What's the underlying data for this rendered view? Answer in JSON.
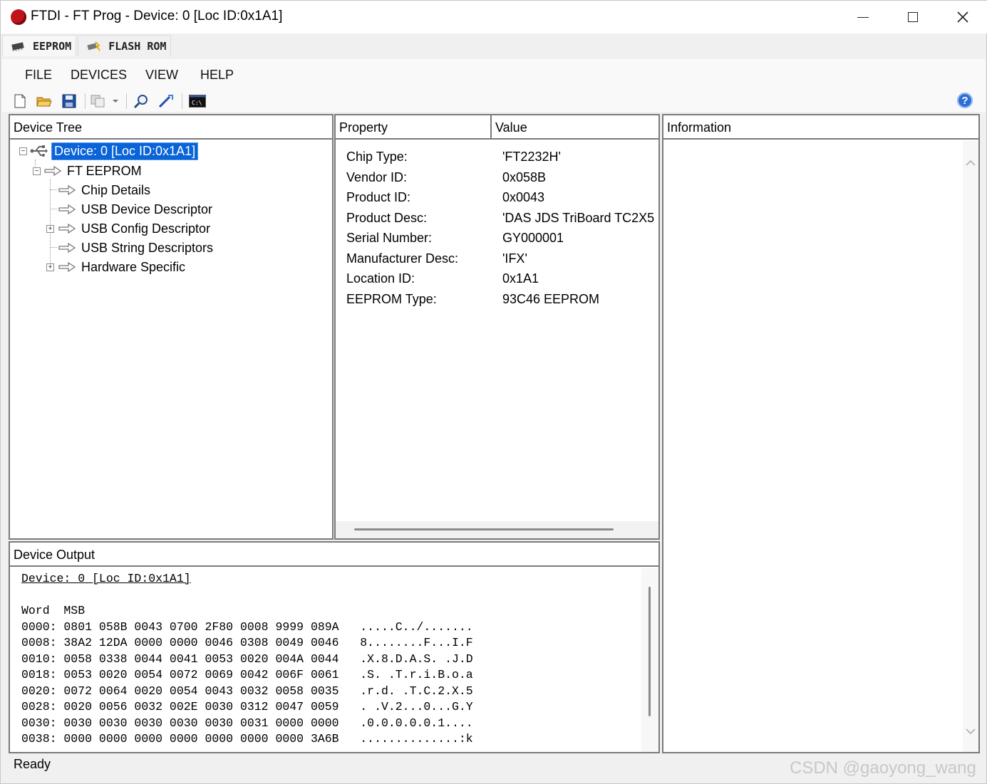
{
  "window": {
    "title": "FTDI - FT Prog - Device: 0 [Loc ID:0x1A1]",
    "controls": {
      "minimize": "minimize-icon",
      "maximize": "maximize-icon",
      "close": "close-icon"
    }
  },
  "tabs": [
    {
      "label": "EEPROM",
      "icon": "chip-icon"
    },
    {
      "label": "FLASH ROM",
      "icon": "flash-icon"
    }
  ],
  "menu": [
    "FILE",
    "DEVICES",
    "VIEW",
    "HELP"
  ],
  "toolbar": {
    "icons": [
      "new-file-icon",
      "open-folder-icon",
      "save-icon",
      "copy-icon",
      "dropdown-icon",
      "search-icon",
      "program-icon",
      "cmd-icon",
      "help-icon"
    ],
    "cmd_label": "C:\\",
    "help_label": "?"
  },
  "device_tree": {
    "header": "Device Tree",
    "root": "Device: 0 [Loc ID:0x1A1]",
    "eeprom": "FT EEPROM",
    "children": [
      "Chip Details",
      "USB Device Descriptor",
      "USB Config Descriptor",
      "USB String Descriptors",
      "Hardware Specific"
    ]
  },
  "properties": {
    "header_property": "Property",
    "header_value": "Value",
    "rows": [
      {
        "name": "Chip Type:",
        "value": "'FT2232H'"
      },
      {
        "name": "Vendor ID:",
        "value": "0x058B"
      },
      {
        "name": "Product ID:",
        "value": "0x0043"
      },
      {
        "name": "Product Desc:",
        "value": "'DAS JDS TriBoard TC2X5"
      },
      {
        "name": "Serial Number:",
        "value": "GY000001"
      },
      {
        "name": "Manufacturer Desc:",
        "value": "'IFX'"
      },
      {
        "name": "Location ID:",
        "value": "0x1A1"
      },
      {
        "name": "EEPROM Type:",
        "value": "93C46 EEPROM"
      }
    ]
  },
  "information": {
    "header": "Information"
  },
  "device_output": {
    "header": "Device Output",
    "device_line": "Device: 0 [Loc ID:0x1A1]",
    "col_header": "Word  MSB",
    "lines": [
      "0000: 0801 058B 0043 0700 2F80 0008 9999 089A   .....C../.......",
      "0008: 38A2 12DA 0000 0000 0046 0308 0049 0046   8........F...I.F",
      "0010: 0058 0338 0044 0041 0053 0020 004A 0044   .X.8.D.A.S. .J.D",
      "0018: 0053 0020 0054 0072 0069 0042 006F 0061   .S. .T.r.i.B.o.a",
      "0020: 0072 0064 0020 0054 0043 0032 0058 0035   .r.d. .T.C.2.X.5",
      "0028: 0020 0056 0032 002E 0030 0312 0047 0059   . .V.2...0...G.Y",
      "0030: 0030 0030 0030 0030 0030 0031 0000 0000   .0.0.0.0.0.1....",
      "0038: 0000 0000 0000 0000 0000 0000 0000 3A6B   ..............:k"
    ]
  },
  "status": "Ready",
  "watermark": "CSDN @gaoyong_wang"
}
